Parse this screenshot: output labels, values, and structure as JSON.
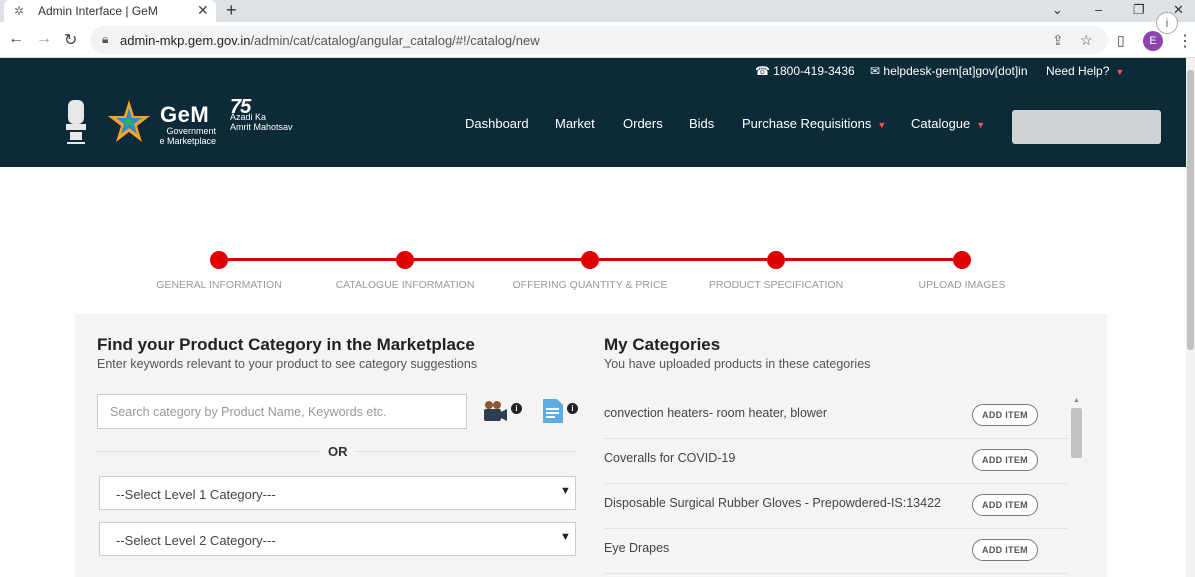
{
  "browser": {
    "tab_title": "Admin Interface | GeM",
    "url_domain": "admin-mkp.gem.gov.in",
    "url_path": "/admin/cat/catalog/angular_catalog/#!/catalog/new",
    "profile_initial": "E"
  },
  "header": {
    "phone": "1800-419-3436",
    "email": "helpdesk-gem[at]gov[dot]in",
    "need_help": "Need Help?",
    "gem_logo": "GeM",
    "gem_sub1": "Government",
    "gem_sub2": "e Marketplace",
    "azadi_num": "75",
    "azadi_line1": "Azadi",
    "azadi_ka": "Ka",
    "azadi_line2": "Amrit Mahotsav",
    "nav": [
      "Dashboard",
      "Market",
      "Orders",
      "Bids",
      "Purchase Requisitions",
      "Catalogue"
    ]
  },
  "steps": [
    "GENERAL INFORMATION",
    "CATALOGUE INFORMATION",
    "OFFERING QUANTITY & PRICE",
    "PRODUCT SPECIFICATION",
    "UPLOAD IMAGES"
  ],
  "find": {
    "title": "Find your Product Category in the Marketplace",
    "subtitle": "Enter keywords relevant to your product to see category suggestions",
    "placeholder": "Search category by Product Name, Keywords etc.",
    "or": "OR",
    "level1": "--Select Level 1 Category---",
    "level2": "--Select Level 2 Category---"
  },
  "my_categories": {
    "title": "My Categories",
    "subtitle": "You have uploaded products in these categories",
    "add_label": "ADD ITEM",
    "items": [
      "convection heaters- room heater, blower",
      "Coveralls for COVID-19",
      "Disposable Surgical Rubber Gloves - Prepowdered-IS:13422",
      "Eye Drapes"
    ]
  },
  "colors": {
    "header_bg": "#0d2a38",
    "step_red": "#e00000",
    "caret_red": "#ff4d4d"
  }
}
